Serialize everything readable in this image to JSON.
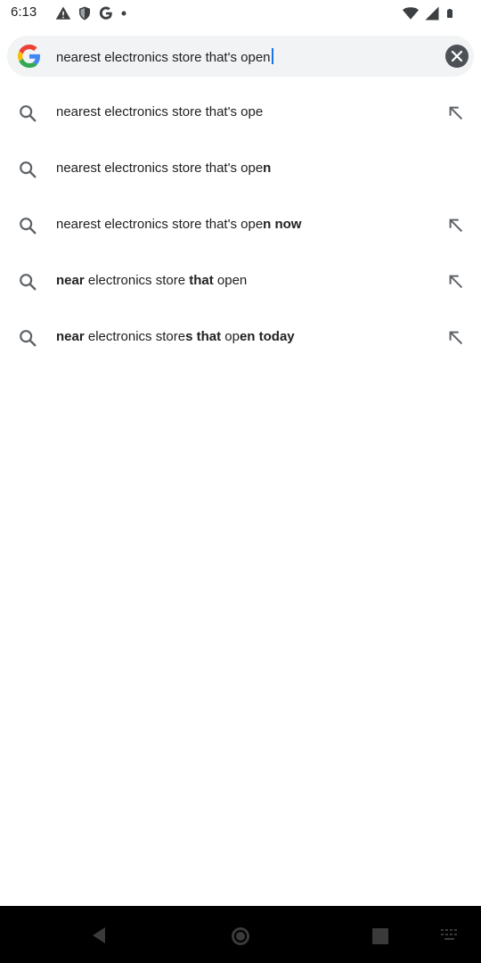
{
  "status_bar": {
    "time": "6:13",
    "left_icons": [
      "warning-icon",
      "shield-icon",
      "google-g-icon",
      "dot-icon"
    ],
    "right_icons": [
      "wifi-icon",
      "signal-icon",
      "battery-icon"
    ]
  },
  "search": {
    "query": "nearest electronics store that's open",
    "logo": "google-g-icon",
    "clear_icon": "close-icon"
  },
  "suggestions": [
    {
      "prefix": "nearest electronics store that's ope",
      "bold": "",
      "rest": "",
      "has_fill_arrow": true
    },
    {
      "prefix": "nearest electronics store that's ope",
      "bold": "n",
      "rest": "",
      "has_fill_arrow": false
    },
    {
      "prefix": "nearest electronics store that's ope",
      "bold": "n now",
      "rest": "",
      "has_fill_arrow": true
    },
    {
      "prefix": "",
      "bold": "near",
      "rest": " electronics store ",
      "bold2": "that",
      "rest2": " open",
      "has_fill_arrow": true
    },
    {
      "prefix": "",
      "bold": "near",
      "rest": " electronics store",
      "bold2": "s that",
      "rest2": " op",
      "bold3": "en today",
      "has_fill_arrow": true
    }
  ],
  "nav_bar": {
    "icons": [
      "back-icon",
      "home-icon",
      "recents-icon",
      "keyboard-icon"
    ]
  },
  "colors": {
    "search_bg": "#f1f3f4",
    "text": "#202124",
    "icon_gray": "#5f6368",
    "caret": "#1a73e8"
  }
}
